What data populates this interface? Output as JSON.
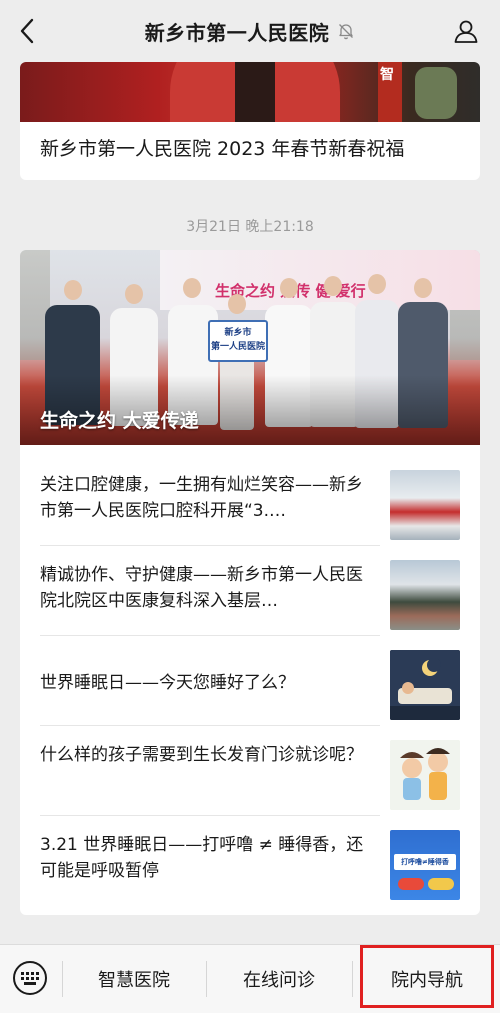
{
  "header": {
    "title": "新乡市第一人民医院"
  },
  "feed": {
    "top_card": {
      "image_sign": "智",
      "title": "新乡市第一人民医院 2023 年春节新春祝福"
    },
    "timestamp": "3月21日 晚上21:18",
    "main_card": {
      "hero_caption": "生命之约 大爱传递",
      "hero_sign_line1": "新乡市",
      "hero_sign_line2": "第一人民医院",
      "hero_banner_text": "生命之约 爱传 健 爱行",
      "articles": [
        {
          "title": "关注口腔健康，一生拥有灿烂笑容——新乡市第一人民医院口腔科开展“3.…"
        },
        {
          "title": "精诚协作、守护健康——新乡市第一人民医院北院区中医康复科深入基层…"
        },
        {
          "title": "世界睡眠日——今天您睡好了么？"
        },
        {
          "title": "什么样的孩子需要到生长发育门诊就诊呢？"
        },
        {
          "title": "3.21 世界睡眠日——打呼噜 ≠ 睡得香，还可能是呼吸暂停"
        }
      ],
      "thumb5_text": "打呼噜≠睡得香"
    }
  },
  "bottom_menu": {
    "items": [
      "智慧医院",
      "在线问诊",
      "院内导航"
    ]
  },
  "colors": {
    "background": "#ededed",
    "card": "#ffffff",
    "highlight": "#e02020",
    "timestamp": "#9a9a9a"
  },
  "icons": {
    "back": "back-arrow-icon",
    "mute": "mute-bell-icon",
    "profile": "user-profile-icon",
    "keyboard": "keyboard-icon"
  }
}
